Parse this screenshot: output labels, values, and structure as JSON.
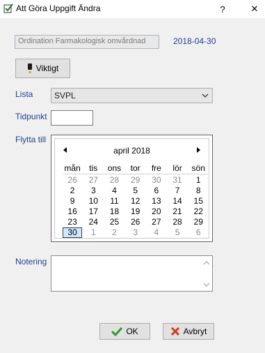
{
  "window": {
    "title": "Att Göra Uppgift Ändra",
    "help_label": "?",
    "close_label": "✕",
    "icon": "checklist-icon"
  },
  "task": {
    "display_value": "Ordination Farmakologisk omvårdnad",
    "date": "2018-04-30"
  },
  "viktigt_button": {
    "label": "Viktigt",
    "icon": "exclamation-icon"
  },
  "form": {
    "lista_label": "Lista",
    "lista_value": "SVPL",
    "tidpunkt_label": "Tidpunkt",
    "tidpunkt_value": "",
    "flytta_label": "Flytta till",
    "notering_label": "Notering",
    "notering_value": ""
  },
  "calendar": {
    "month_label": "april 2018",
    "weekdays": [
      "mån",
      "tis",
      "ons",
      "tor",
      "fre",
      "lör",
      "sön"
    ],
    "weeks": [
      [
        "26",
        "27",
        "28",
        "29",
        "30",
        "31",
        "1"
      ],
      [
        "2",
        "3",
        "4",
        "5",
        "6",
        "7",
        "8"
      ],
      [
        "9",
        "10",
        "11",
        "12",
        "13",
        "14",
        "15"
      ],
      [
        "16",
        "17",
        "18",
        "19",
        "20",
        "21",
        "22"
      ],
      [
        "23",
        "24",
        "25",
        "26",
        "27",
        "28",
        "29"
      ],
      [
        "30",
        "1",
        "2",
        "3",
        "4",
        "5",
        "6"
      ]
    ],
    "selected_day": "30"
  },
  "buttons": {
    "ok_label": "OK",
    "cancel_label": "Avbryt"
  },
  "colors": {
    "label_blue": "#1f3e8e",
    "ok_green": "#2e9e2e",
    "cancel_red": "#d63a1e",
    "selected_day_bg": "#cde8ff"
  }
}
